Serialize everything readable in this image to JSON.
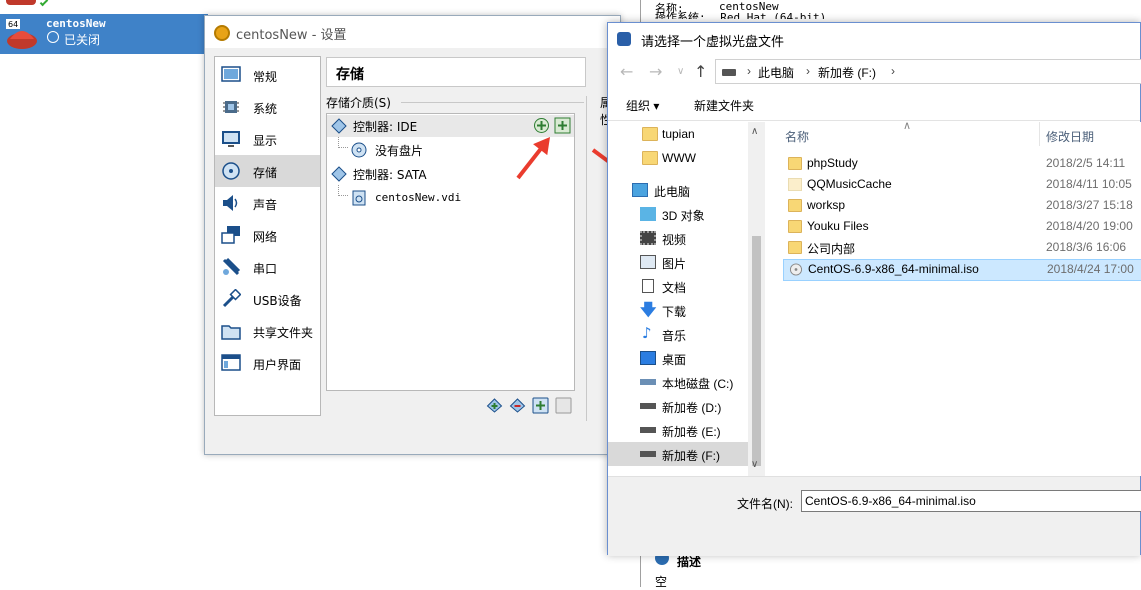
{
  "manager": {
    "vm_name": "centosNew",
    "vm_badge": "64",
    "vm_state": "已关闭",
    "details_name_label": "名称:",
    "details_name_value": "centosNew",
    "details_os_label": "操作系统:",
    "details_os_value": "Red Hat (64-bit)",
    "description_header": "描述",
    "description_value": "空"
  },
  "settings": {
    "title": "centosNew - 设置",
    "page_title": "存储",
    "storage_devices_label": "存储介质(S)",
    "attributes_label": "属性",
    "nav": [
      {
        "label": "常规"
      },
      {
        "label": "系统"
      },
      {
        "label": "显示"
      },
      {
        "label": "存储"
      },
      {
        "label": "声音"
      },
      {
        "label": "网络"
      },
      {
        "label": "串口"
      },
      {
        "label": "USB设备"
      },
      {
        "label": "共享文件夹"
      },
      {
        "label": "用户界面"
      }
    ],
    "tree": {
      "ide_controller": "控制器: IDE",
      "empty_disk": "没有盘片",
      "sata_controller": "控制器: SATA",
      "vdi_file": "centosNew.vdi"
    }
  },
  "file_dialog": {
    "title": "请选择一个虚拟光盘文件",
    "breadcrumb": [
      "此电脑",
      "新加卷 (F:)"
    ],
    "organize": "组织 ▾",
    "new_folder": "新建文件夹",
    "left_pane": [
      {
        "label": "tupian",
        "icon": "folder-icon"
      },
      {
        "label": "WWW",
        "icon": "folder-icon"
      },
      {
        "label": "此电脑",
        "icon": "computer-icon"
      },
      {
        "label": "3D 对象",
        "icon": "3d-objects-icon"
      },
      {
        "label": "视频",
        "icon": "video-icon"
      },
      {
        "label": "图片",
        "icon": "pictures-icon"
      },
      {
        "label": "文档",
        "icon": "documents-icon"
      },
      {
        "label": "下载",
        "icon": "download-icon"
      },
      {
        "label": "音乐",
        "icon": "music-icon"
      },
      {
        "label": "桌面",
        "icon": "desktop-icon"
      },
      {
        "label": "本地磁盘 (C:)",
        "icon": "drive-icon"
      },
      {
        "label": "新加卷 (D:)",
        "icon": "drive-icon"
      },
      {
        "label": "新加卷 (E:)",
        "icon": "drive-icon"
      },
      {
        "label": "新加卷 (F:)",
        "icon": "drive-icon"
      }
    ],
    "columns": {
      "name": "名称",
      "modified": "修改日期"
    },
    "files": [
      {
        "name": "phpStudy",
        "date": "2018/2/5 14:11",
        "type": "folder"
      },
      {
        "name": "QQMusicCache",
        "date": "2018/4/11 10:05",
        "type": "folder"
      },
      {
        "name": "worksp",
        "date": "2018/3/27 15:18",
        "type": "folder"
      },
      {
        "name": "Youku Files",
        "date": "2018/4/20 19:00",
        "type": "folder"
      },
      {
        "name": "公司内部",
        "date": "2018/3/6 16:06",
        "type": "folder"
      },
      {
        "name": "CentOS-6.9-x86_64-minimal.iso",
        "date": "2018/4/24 17:00",
        "type": "iso"
      }
    ],
    "filename_label": "文件名(N):",
    "filename_value": "CentOS-6.9-x86_64-minimal.iso"
  },
  "colors": {
    "vm_selected": "#3f82c8",
    "annotation_arrow": "#ea3c2e",
    "file_selected": "#cce8ff"
  }
}
